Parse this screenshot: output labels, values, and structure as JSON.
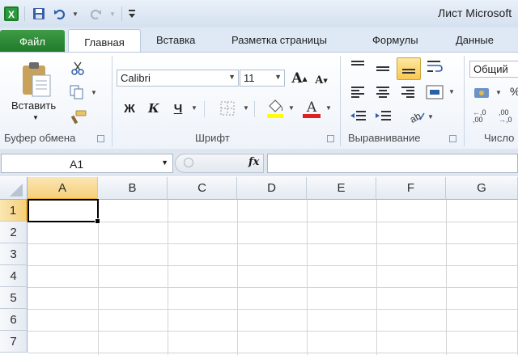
{
  "titlebar": {
    "title": "Лист Microsoft"
  },
  "tabs": [
    "Файл",
    "Главная",
    "Вставка",
    "Разметка страницы",
    "Формулы",
    "Данные"
  ],
  "ribbon": {
    "clipboard": {
      "paste_label": "Вставить",
      "group_label": "Буфер обмена"
    },
    "font": {
      "font_name": "Calibri",
      "font_size": "11",
      "bold": "Ж",
      "italic": "К",
      "underline": "Ч",
      "group_label": "Шрифт"
    },
    "alignment": {
      "group_label": "Выравнивание"
    },
    "number": {
      "format": "Общий",
      "percent": "%",
      "group_label": "Число"
    }
  },
  "formula_bar": {
    "name_box": "A1",
    "fx": "fx",
    "content": ""
  },
  "sheet": {
    "columns": [
      "A",
      "B",
      "C",
      "D",
      "E",
      "F",
      "G"
    ],
    "rows": [
      "1",
      "2",
      "3",
      "4",
      "5",
      "6",
      "7"
    ],
    "selected_cell": "A1"
  },
  "colors": {
    "file_tab": "#2a8a36",
    "selection": "#000000",
    "active_header": "#f9d98a"
  },
  "icons": [
    "excel-logo-icon",
    "save-icon",
    "undo-icon",
    "redo-icon",
    "customize-icon",
    "paste-icon",
    "cut-icon",
    "copy-icon",
    "format-painter-icon",
    "fill-color-icon",
    "font-color-icon",
    "borders-icon",
    "wrap-text-icon",
    "merge-icon",
    "currency-icon"
  ]
}
